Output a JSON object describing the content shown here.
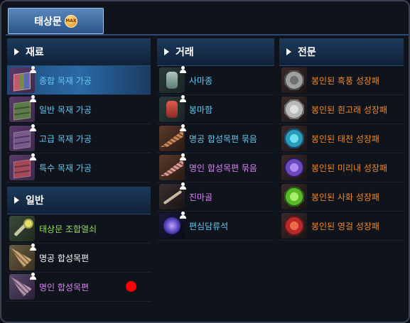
{
  "tab": {
    "label": "태상문",
    "badge": "MAX"
  },
  "materials": {
    "header": "재료",
    "items": [
      {
        "label": "종합 목재 가공",
        "icon": "multi-cube-icon"
      },
      {
        "label": "일반 목재 가공",
        "icon": "green-cube-icon"
      },
      {
        "label": "고급 목재 가공",
        "icon": "purple-cube-icon"
      },
      {
        "label": "특수 목재 가공",
        "icon": "red-cube-icon"
      }
    ]
  },
  "general": {
    "header": "일반",
    "items": [
      {
        "label": "태상문 조합열쇠",
        "icon": "key-icon"
      },
      {
        "label": "명공 합성목편",
        "icon": "plank-icon"
      },
      {
        "label": "명인 합성목편",
        "icon": "purple-plank-icon"
      }
    ]
  },
  "trade": {
    "header": "거래",
    "items": [
      {
        "label": "사마종",
        "icon": "jar-icon"
      },
      {
        "label": "봉마함",
        "icon": "red-jar-icon"
      },
      {
        "label": "명공 합성목편 묶음",
        "icon": "plank-bundle-icon"
      },
      {
        "label": "명인 합성목편 묶음",
        "icon": "purple-plank-bundle-icon"
      },
      {
        "label": "진마골",
        "icon": "bone-icon"
      },
      {
        "label": "편심담류석",
        "icon": "gem-icon"
      }
    ]
  },
  "specialty": {
    "header": "전문",
    "items": [
      {
        "label": "봉인된 흑풍 성장패",
        "icon": "black-wind-medal-icon"
      },
      {
        "label": "봉인된 흰고래 성장패",
        "icon": "white-whale-medal-icon"
      },
      {
        "label": "봉인된 태천 성장패",
        "icon": "taecheon-medal-icon"
      },
      {
        "label": "봉인된 미리내 성장패",
        "icon": "mirinae-medal-icon"
      },
      {
        "label": "봉인된 사화 성장패",
        "icon": "sahwa-medal-icon"
      },
      {
        "label": "봉인된 영걸 성장패",
        "icon": "yeonggeol-medal-icon"
      }
    ]
  },
  "colors": {
    "blue_text": "#68c8f0",
    "green_text": "#8fe05a",
    "purple_text": "#d884f4",
    "orange_text": "#f08a2a",
    "notification_dot": "#ff0000"
  }
}
